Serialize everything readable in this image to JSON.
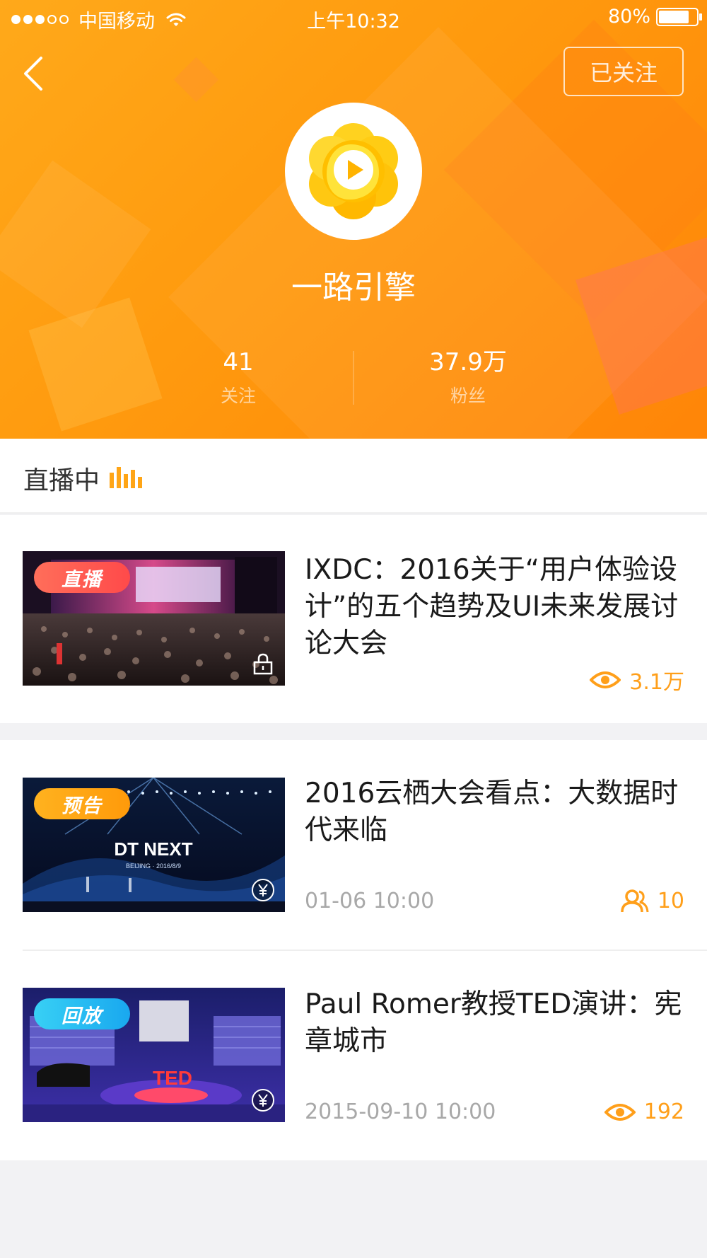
{
  "status_bar": {
    "carrier": "中国移动",
    "time": "上午10:32",
    "battery_percent": "80%",
    "battery_level": 0.8,
    "signal_bars_filled": 3,
    "signal_bars_total": 5
  },
  "profile": {
    "follow_button_label": "已关注",
    "name": "一路引擎",
    "stats": {
      "following_value": "41",
      "following_label": "关注",
      "fans_value": "37.9万",
      "fans_label": "粉丝"
    }
  },
  "live_section": {
    "title": "直播中",
    "icon": "bars-icon"
  },
  "items": [
    {
      "badge": "直播",
      "badge_color": "#ff5a50",
      "title": "IXDC：2016关于“用户体验设计”的五个趋势及UI未来发展讨论大会",
      "date": "",
      "metric_icon": "eye-icon",
      "metric_value": "3.1万",
      "thumb_icon": "lock-icon"
    },
    {
      "badge": "预告",
      "badge_color": "#ffa515",
      "title": "2016云栖大会看点：大数据时代来临",
      "date": "01-06 10:00",
      "metric_icon": "users-icon",
      "metric_value": "10",
      "thumb_icon": "yen-icon",
      "thumb_text_1": "DT NEXT",
      "thumb_text_2": "BEIJING · 2016/8/9"
    },
    {
      "badge": "回放",
      "badge_color": "#22b5f2",
      "title": "Paul Romer教授TED演讲：宪章城市",
      "date": "2015-09-10 10:00",
      "metric_icon": "eye-icon",
      "metric_value": "192",
      "thumb_icon": "yen-icon",
      "thumb_text_1": "TED"
    }
  ],
  "colors": {
    "header_start": "#ffa91a",
    "header_end": "#ff8508",
    "accent": "#ff9f1a"
  }
}
